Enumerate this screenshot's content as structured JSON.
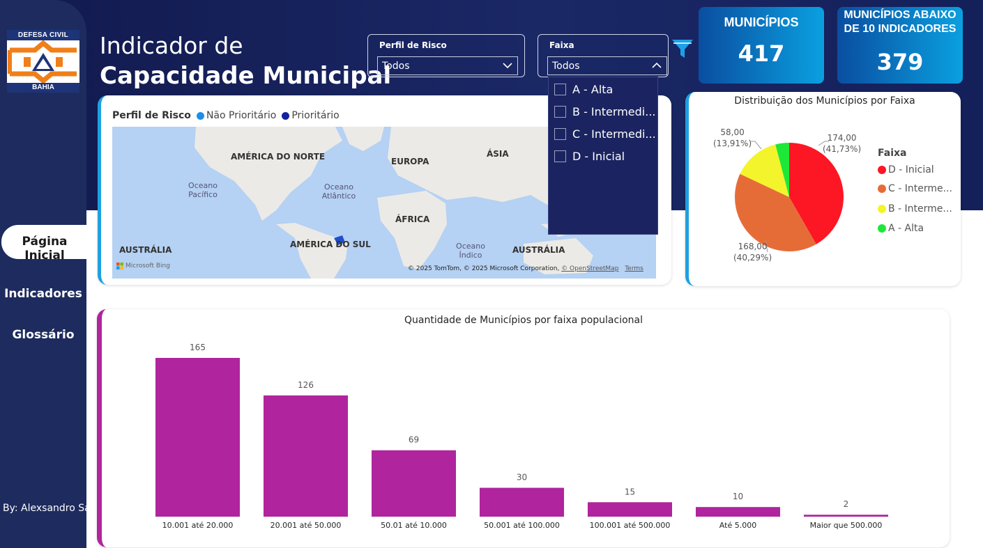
{
  "logo": {
    "top_text": "DEFESA CIVIL",
    "bottom_text": "BAHIA"
  },
  "header": {
    "title_line1": "Indicador de",
    "title_line2": "Capacidade Municipal"
  },
  "nav": {
    "items": [
      {
        "label": "Página Inicial",
        "active": true
      },
      {
        "label": "Indicadores",
        "active": false
      },
      {
        "label": "Glossário",
        "active": false
      }
    ]
  },
  "byline": "By: Alexsandro Sá",
  "slicers": {
    "perfil": {
      "label": "Perfil de Risco",
      "value": "Todos"
    },
    "faixa": {
      "label": "Faixa",
      "value": "Todos",
      "options": [
        "A - Alta",
        "B - Intermedi...",
        "C - Intermedi...",
        "D - Inicial"
      ]
    }
  },
  "kpis": [
    {
      "title_lines": [
        "MUNICÍPIOS"
      ],
      "value": "417"
    },
    {
      "title_lines": [
        "MUNICÍPIOS ABAIXO",
        "DE 10 INDICADORES"
      ],
      "value": "379"
    }
  ],
  "map": {
    "legend_title": "Perfil de Risco",
    "legend_items": [
      {
        "label": "Não Prioritário",
        "color": "#1f8ee8"
      },
      {
        "label": "Prioritário",
        "color": "#12239e"
      }
    ],
    "labels": {
      "north_america": "AMÉRICA DO NORTE",
      "europe": "EUROPA",
      "asia": "ÁSIA",
      "pacific": "Oceano Pacífico",
      "atlantic": "Oceano Atlântico",
      "africa": "ÁFRICA",
      "australia_left": "AUSTRÁLIA",
      "south_america": "AMÉRICA DO SUL",
      "indian": "Oceano Índico",
      "australia_right": "AUSTRÁLIA",
      "bing": "Microsoft Bing",
      "copyright": "© 2025 TomTom, © 2025 Microsoft Corporation,",
      "osm": "© OpenStreetMap",
      "terms": "Terms"
    }
  },
  "chart_data": [
    {
      "type": "pie",
      "title": "Distribuição dos Municípios por Faixa",
      "legend_title": "Faixa",
      "legend_position": "right",
      "slices": [
        {
          "label": "D - Inicial",
          "value": 174,
          "display": "174,00",
          "pct": "(41,73%)",
          "color": "#fd1623"
        },
        {
          "label": "C - Interme...",
          "value": 168,
          "display": "168,00",
          "pct": "(40,29%)",
          "color": "#e66c37"
        },
        {
          "label": "B - Interme...",
          "value": 58,
          "display": "58,00",
          "pct": "(13,91%)",
          "color": "#f3f42c"
        },
        {
          "label": "A - Alta",
          "value": 17,
          "color": "#1ee837"
        }
      ]
    },
    {
      "type": "bar",
      "title": "Quantidade de Municípios por faixa populacional",
      "categories": [
        "10.001 até 20.000",
        "20.001 até 50.000",
        "50.01 até 10.000",
        "50.001 até 100.000",
        "100.001 até 500.000",
        "Até 5.000",
        "Maior que 500.000"
      ],
      "values": [
        165,
        126,
        69,
        30,
        15,
        10,
        2
      ],
      "color": "#b0249e",
      "ylim": [
        0,
        165
      ],
      "grid": false
    }
  ]
}
